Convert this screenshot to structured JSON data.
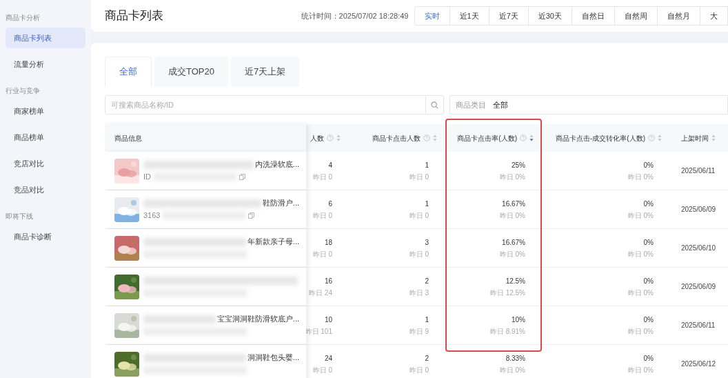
{
  "sidebar": {
    "groups": [
      {
        "title": "商品卡分析",
        "items": [
          {
            "label": "商品卡列表",
            "selected": true
          },
          {
            "label": "流量分析",
            "selected": false
          }
        ]
      },
      {
        "title": "行业与竞争",
        "items": [
          {
            "label": "商家榜单",
            "selected": false
          },
          {
            "label": "商品榜单",
            "selected": false
          },
          {
            "label": "竞店对比",
            "selected": false
          },
          {
            "label": "竞品对比",
            "selected": false
          }
        ]
      },
      {
        "title": "即将下线",
        "items": [
          {
            "label": "商品卡诊断",
            "selected": false
          }
        ]
      }
    ]
  },
  "header": {
    "title": "商品卡列表",
    "stat_time": "统计时间：2025/07/02 18:28:49",
    "ranges": [
      {
        "label": "实时",
        "selected": true
      },
      {
        "label": "近1天",
        "selected": false
      },
      {
        "label": "近7天",
        "selected": false
      },
      {
        "label": "近30天",
        "selected": false
      },
      {
        "label": "自然日",
        "selected": false
      },
      {
        "label": "自然周",
        "selected": false
      },
      {
        "label": "自然月",
        "selected": false
      },
      {
        "label": "大",
        "selected": false
      }
    ]
  },
  "tabs": [
    {
      "label": "全部",
      "selected": true
    },
    {
      "label": "成交TOP20",
      "selected": false
    },
    {
      "label": "近7天上架",
      "selected": false
    }
  ],
  "search": {
    "placeholder": "可搜索商品名称/ID"
  },
  "category_filter": {
    "label": "商品类目",
    "value": "全部"
  },
  "table": {
    "columns": [
      {
        "label": "商品信息",
        "sortable": false,
        "help": false
      },
      {
        "label": "人数",
        "sortable": true,
        "sorted_desc": false,
        "help": true
      },
      {
        "label": "商品卡点击人数",
        "sortable": true,
        "sorted_desc": false,
        "help": true
      },
      {
        "label": "商品卡点击率(人数)",
        "sortable": true,
        "sorted_desc": true,
        "help": true,
        "highlighted": true
      },
      {
        "label": "商品卡点击-成交转化率(人数)",
        "sortable": true,
        "sorted_desc": false,
        "help": true
      },
      {
        "label": "上架时间",
        "sortable": true,
        "sorted_desc": false,
        "help": false
      }
    ],
    "rows": [
      {
        "cells": [
          {
            "kind": "product",
            "name": "内洗澡软底...",
            "id": "ID"
          },
          {
            "value": "4",
            "previous": "昨日 0"
          },
          {
            "value": "1",
            "previous": "昨日 0"
          },
          {
            "value": "25%",
            "previous": "昨日 0%"
          },
          {
            "value": "0%",
            "previous": "昨日 0%"
          },
          {
            "value": "2025/06/11"
          }
        ]
      },
      {
        "cells": [
          {
            "kind": "product",
            "name": "鞋防滑户...",
            "id": "3163"
          },
          {
            "value": "6",
            "previous": "昨日 0"
          },
          {
            "value": "1",
            "previous": "昨日 0"
          },
          {
            "value": "16.67%",
            "previous": "昨日 0%"
          },
          {
            "value": "0%",
            "previous": "昨日 0%"
          },
          {
            "value": "2025/06/09"
          }
        ]
      },
      {
        "cells": [
          {
            "kind": "product",
            "name": "年新款亲子母..."
          },
          {
            "value": "18",
            "previous": "昨日 0"
          },
          {
            "value": "3",
            "previous": "昨日 0"
          },
          {
            "value": "16.67%",
            "previous": "昨日 0%"
          },
          {
            "value": "0%",
            "previous": "昨日 0%"
          },
          {
            "value": "2025/06/10"
          }
        ]
      },
      {
        "cells": [
          {
            "kind": "product"
          },
          {
            "value": "16",
            "previous": "昨日 24"
          },
          {
            "value": "2",
            "previous": "昨日 3"
          },
          {
            "value": "12.5%",
            "previous": "昨日 12.5%"
          },
          {
            "value": "0%",
            "previous": "昨日 0%"
          },
          {
            "value": "2025/06/09"
          }
        ]
      },
      {
        "cells": [
          {
            "kind": "product",
            "name": "宝宝洞洞鞋防滑软底户..."
          },
          {
            "value": "10",
            "previous": "昨日 101"
          },
          {
            "value": "1",
            "previous": "昨日 9"
          },
          {
            "value": "10%",
            "previous": "昨日 8.91%"
          },
          {
            "value": "0%",
            "previous": "昨日 0%"
          },
          {
            "value": "2025/06/11"
          }
        ]
      },
      {
        "cells": [
          {
            "kind": "product",
            "name": "洞洞鞋包头婴..."
          },
          {
            "value": "24",
            "previous": "昨日 0"
          },
          {
            "value": "2",
            "previous": "昨日 0"
          },
          {
            "value": "8.33%",
            "previous": "昨日 0%"
          },
          {
            "value": "0%",
            "previous": "昨日 0%"
          },
          {
            "value": "2025/06/12"
          }
        ]
      }
    ]
  }
}
